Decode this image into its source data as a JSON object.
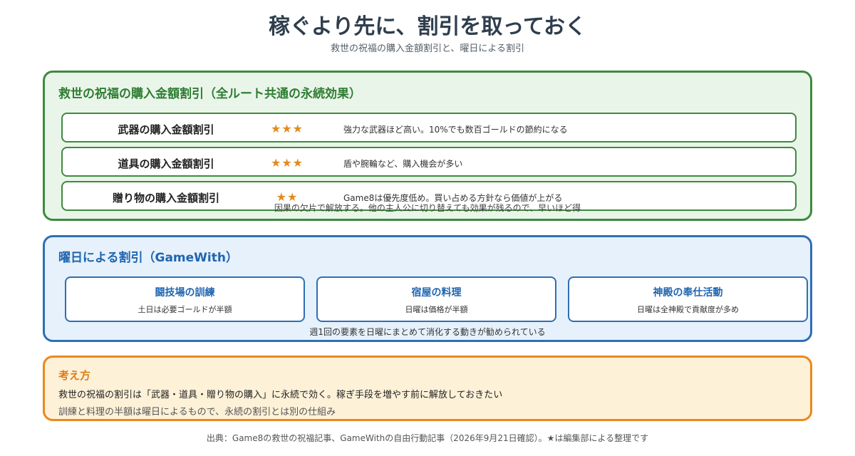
{
  "title": "稼ぐより先に、割引を取っておく",
  "subtitle": "救世の祝福の購入金額割引と、曜日による割引",
  "blessing": {
    "heading": "救世の祝福の購入金額割引（全ルート共通の永続効果）",
    "rows": [
      {
        "name": "武器の購入金額割引",
        "stars": "★★★",
        "note": "強力な武器ほど高い。10%でも数百ゴールドの節約になる"
      },
      {
        "name": "道具の購入金額割引",
        "stars": "★★★",
        "note": "盾や腕輪など、購入機会が多い"
      },
      {
        "name": "贈り物の購入金額割引",
        "stars": "★★",
        "note": "Game8は優先度低め。買い占める方針なら価値が上がる"
      }
    ],
    "footnote": "因果の欠片で解放する。他の主人公に切り替えても効果が残るので、早いほど得"
  },
  "weekday": {
    "heading": "曜日による割引（GameWith）",
    "cards": [
      {
        "title": "闘技場の訓練",
        "desc": "土日は必要ゴールドが半額"
      },
      {
        "title": "宿屋の料理",
        "desc": "日曜は価格が半額"
      },
      {
        "title": "神殿の奉仕活動",
        "desc": "日曜は全神殿で貢献度が多め"
      }
    ],
    "footnote": "週1回の要素を日曜にまとめて消化する動きが勧められている"
  },
  "thinking": {
    "heading": "考え方",
    "line1": "救世の祝福の割引は「武器・道具・贈り物の購入」に永続で効く。稼ぎ手段を増やす前に解放しておきたい",
    "line2": "訓練と料理の半額は曜日によるもので、永続の割引とは別の仕組み"
  },
  "source": "出典：Game8の救世の祝福記事、GameWithの自由行動記事（2026年9月21日確認）。★は編集部による整理です",
  "colors": {
    "green": "#3e8a3e",
    "blue": "#2f6fb3",
    "orange": "#e9891f",
    "star": "#e48a1c"
  }
}
